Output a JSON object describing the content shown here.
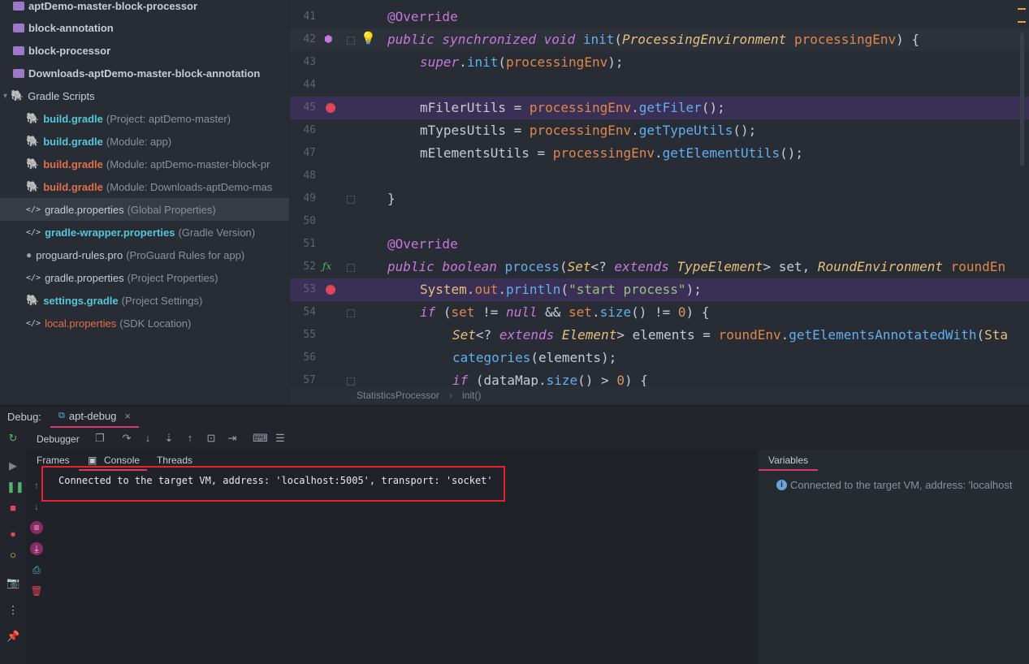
{
  "project_tree": {
    "items": [
      {
        "name": "aptDemo-master-block-processor",
        "sub": "",
        "type": "folder"
      },
      {
        "name": "block-annotation",
        "sub": "",
        "type": "folder"
      },
      {
        "name": "block-processor",
        "sub": "",
        "type": "folder"
      },
      {
        "name": "Downloads-aptDemo-master-block-annotation",
        "sub": "",
        "type": "folder"
      },
      {
        "name": "Gradle Scripts",
        "sub": "",
        "type": "group"
      },
      {
        "name": "build.gradle",
        "sub": "(Project: aptDemo-master)",
        "type": "gradle"
      },
      {
        "name": "build.gradle",
        "sub": "(Module: app)",
        "type": "gradle"
      },
      {
        "name": "build.gradle",
        "sub": "(Module: aptDemo-master-block-pr",
        "type": "gradle-red"
      },
      {
        "name": "build.gradle",
        "sub": "(Module: Downloads-aptDemo-mas",
        "type": "gradle-red"
      },
      {
        "name": "gradle.properties",
        "sub": "(Global Properties)",
        "type": "props-sel"
      },
      {
        "name": "gradle-wrapper.properties",
        "sub": "(Gradle Version)",
        "type": "props-bold"
      },
      {
        "name": "proguard-rules.pro",
        "sub": "(ProGuard Rules for app)",
        "type": "proguard"
      },
      {
        "name": "gradle.properties",
        "sub": "(Project Properties)",
        "type": "props"
      },
      {
        "name": "settings.gradle",
        "sub": "(Project Settings)",
        "type": "gradle"
      },
      {
        "name": "local.properties",
        "sub": "(SDK Location)",
        "type": "props-red"
      }
    ]
  },
  "editor": {
    "line_numbers": [
      "41",
      "42",
      "43",
      "44",
      "45",
      "46",
      "47",
      "48",
      "49",
      "50",
      "51",
      "52",
      "53",
      "54",
      "55",
      "56",
      "57"
    ],
    "breadcrumb": [
      "StatisticsProcessor",
      "init()"
    ],
    "code": {
      "l41": "@Override",
      "l42_kw": "public synchronized void",
      "l42_fn": "init",
      "l42_ty": "ProcessingEnvironment",
      "l42_pm": "processingEnv",
      "l43_kw": "super",
      "l43_fn": "init",
      "l43_pm": "processingEnv",
      "l45_var": "mFilerUtils",
      "l45_pm": "processingEnv",
      "l45_fn": "getFiler",
      "l46_var": "mTypesUtils",
      "l46_pm": "processingEnv",
      "l46_fn": "getTypeUtils",
      "l47_var": "mElementsUtils",
      "l47_pm": "processingEnv",
      "l47_fn": "getElementUtils",
      "l49": "}",
      "l51": "@Override",
      "l52_kw": "public boolean",
      "l52_fn": "process",
      "l52_ty1": "Set",
      "l52_kw2": "extends",
      "l52_ty2": "TypeElement",
      "l52_set": "set",
      "l52_ty3": "RoundEnvironment",
      "l52_pm": "roundEn",
      "l53_obj": "System",
      "l53_out": "out",
      "l53_fn": "println",
      "l53_str": "\"start process\"",
      "l54_kw": "if",
      "l54_set": "set",
      "l54_null": "null",
      "l54_size": "size",
      "l54_num": "0",
      "l55_ty1": "Set",
      "l55_kw": "extends",
      "l55_ty2": "Element",
      "l55_var": "elements",
      "l55_pm": "roundEnv",
      "l55_fn": "getElementsAnnotatedWith",
      "l55_tail": "Sta",
      "l56_fn": "categories",
      "l56_var": "elements",
      "l57_kw": "if",
      "l57_var": "dataMap",
      "l57_fn": "size",
      "l57_num": "0"
    }
  },
  "debug": {
    "label": "Debug:",
    "session_tab": "apt-debug",
    "session_close": "×",
    "debugger_tab": "Debugger",
    "subtabs": [
      "Frames",
      "Console",
      "Threads"
    ],
    "console_output": "Connected to the target VM, address: 'localhost:5005', transport: 'socket'",
    "variables_tab": "Variables",
    "variables_msg": "Connected to the target VM, address: 'localhost"
  },
  "colors": {
    "accent": "#d93a6c",
    "highlight_box": "#e8212a",
    "breakpoint": "#e0455a"
  }
}
